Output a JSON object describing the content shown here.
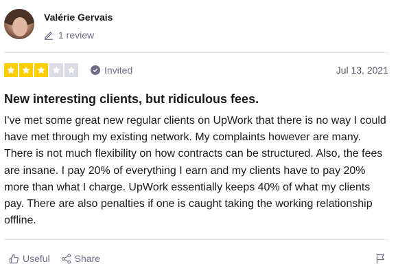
{
  "reviewer": {
    "name": "Valérie Gervais",
    "review_count": "1 review"
  },
  "rating": {
    "stars": 3,
    "max": 5,
    "star_color": "#ffce00",
    "empty_color": "#dcdce6",
    "invited_label": "Invited",
    "date": "Jul 13, 2021"
  },
  "review": {
    "title": "New interesting clients, but ridiculous fees.",
    "body": "I've met some great new regular clients on UpWork that there is no way I could have met through my existing network. My complaints however are many. There is not much flexibility on how contracts can be structured. Also, the fees are insane. I pay 20% of everything I earn and my clients have to pay 20% more than what I charge. UpWork essentially keeps 40% of what my clients pay. There are also penalties if one is caught taking the working relationship offline."
  },
  "actions": {
    "useful_label": "Useful",
    "share_label": "Share"
  }
}
